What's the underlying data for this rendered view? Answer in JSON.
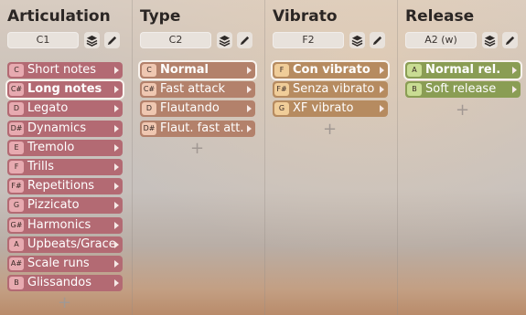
{
  "colors": {
    "articulation_item": "#b36a73",
    "articulation_note": "#e7aab0",
    "type_item": "#b3816b",
    "type_note": "#efc7b1",
    "vibrato_item": "#b68b60",
    "vibrato_note": "#f0cd99",
    "release_item": "#8a9d54",
    "release_note": "#c9dc93"
  },
  "columns": [
    {
      "title": "Articulation",
      "keyswitch": "C1",
      "items": [
        {
          "note": "C",
          "label": "Short notes",
          "selected": false
        },
        {
          "note": "C#",
          "label": "Long notes",
          "selected": true
        },
        {
          "note": "D",
          "label": "Legato",
          "selected": false
        },
        {
          "note": "D#",
          "label": "Dynamics",
          "selected": false
        },
        {
          "note": "E",
          "label": "Tremolo",
          "selected": false
        },
        {
          "note": "F",
          "label": "Trills",
          "selected": false
        },
        {
          "note": "F#",
          "label": "Repetitions",
          "selected": false
        },
        {
          "note": "G",
          "label": "Pizzicato",
          "selected": false
        },
        {
          "note": "G#",
          "label": "Harmonics",
          "selected": false
        },
        {
          "note": "A",
          "label": "Upbeats/Grace",
          "selected": false
        },
        {
          "note": "A#",
          "label": "Scale runs",
          "selected": false
        },
        {
          "note": "B",
          "label": "Glissandos",
          "selected": false
        }
      ],
      "add_label": "+"
    },
    {
      "title": "Type",
      "keyswitch": "C2",
      "items": [
        {
          "note": "C",
          "label": "Normal",
          "selected": true
        },
        {
          "note": "C#",
          "label": "Fast attack",
          "selected": false
        },
        {
          "note": "D",
          "label": "Flautando",
          "selected": false
        },
        {
          "note": "D#",
          "label": "Flaut. fast att.",
          "selected": false
        }
      ],
      "add_label": "+"
    },
    {
      "title": "Vibrato",
      "keyswitch": "F2",
      "items": [
        {
          "note": "F",
          "label": "Con vibrato",
          "selected": true
        },
        {
          "note": "F#",
          "label": "Senza vibrato",
          "selected": false
        },
        {
          "note": "G",
          "label": "XF vibrato",
          "selected": false
        }
      ],
      "add_label": "+"
    },
    {
      "title": "Release",
      "keyswitch": "A2 (w)",
      "items": [
        {
          "note": "A",
          "label": "Normal rel.",
          "selected": true
        },
        {
          "note": "B",
          "label": "Soft release",
          "selected": false
        }
      ],
      "add_label": "+"
    }
  ]
}
